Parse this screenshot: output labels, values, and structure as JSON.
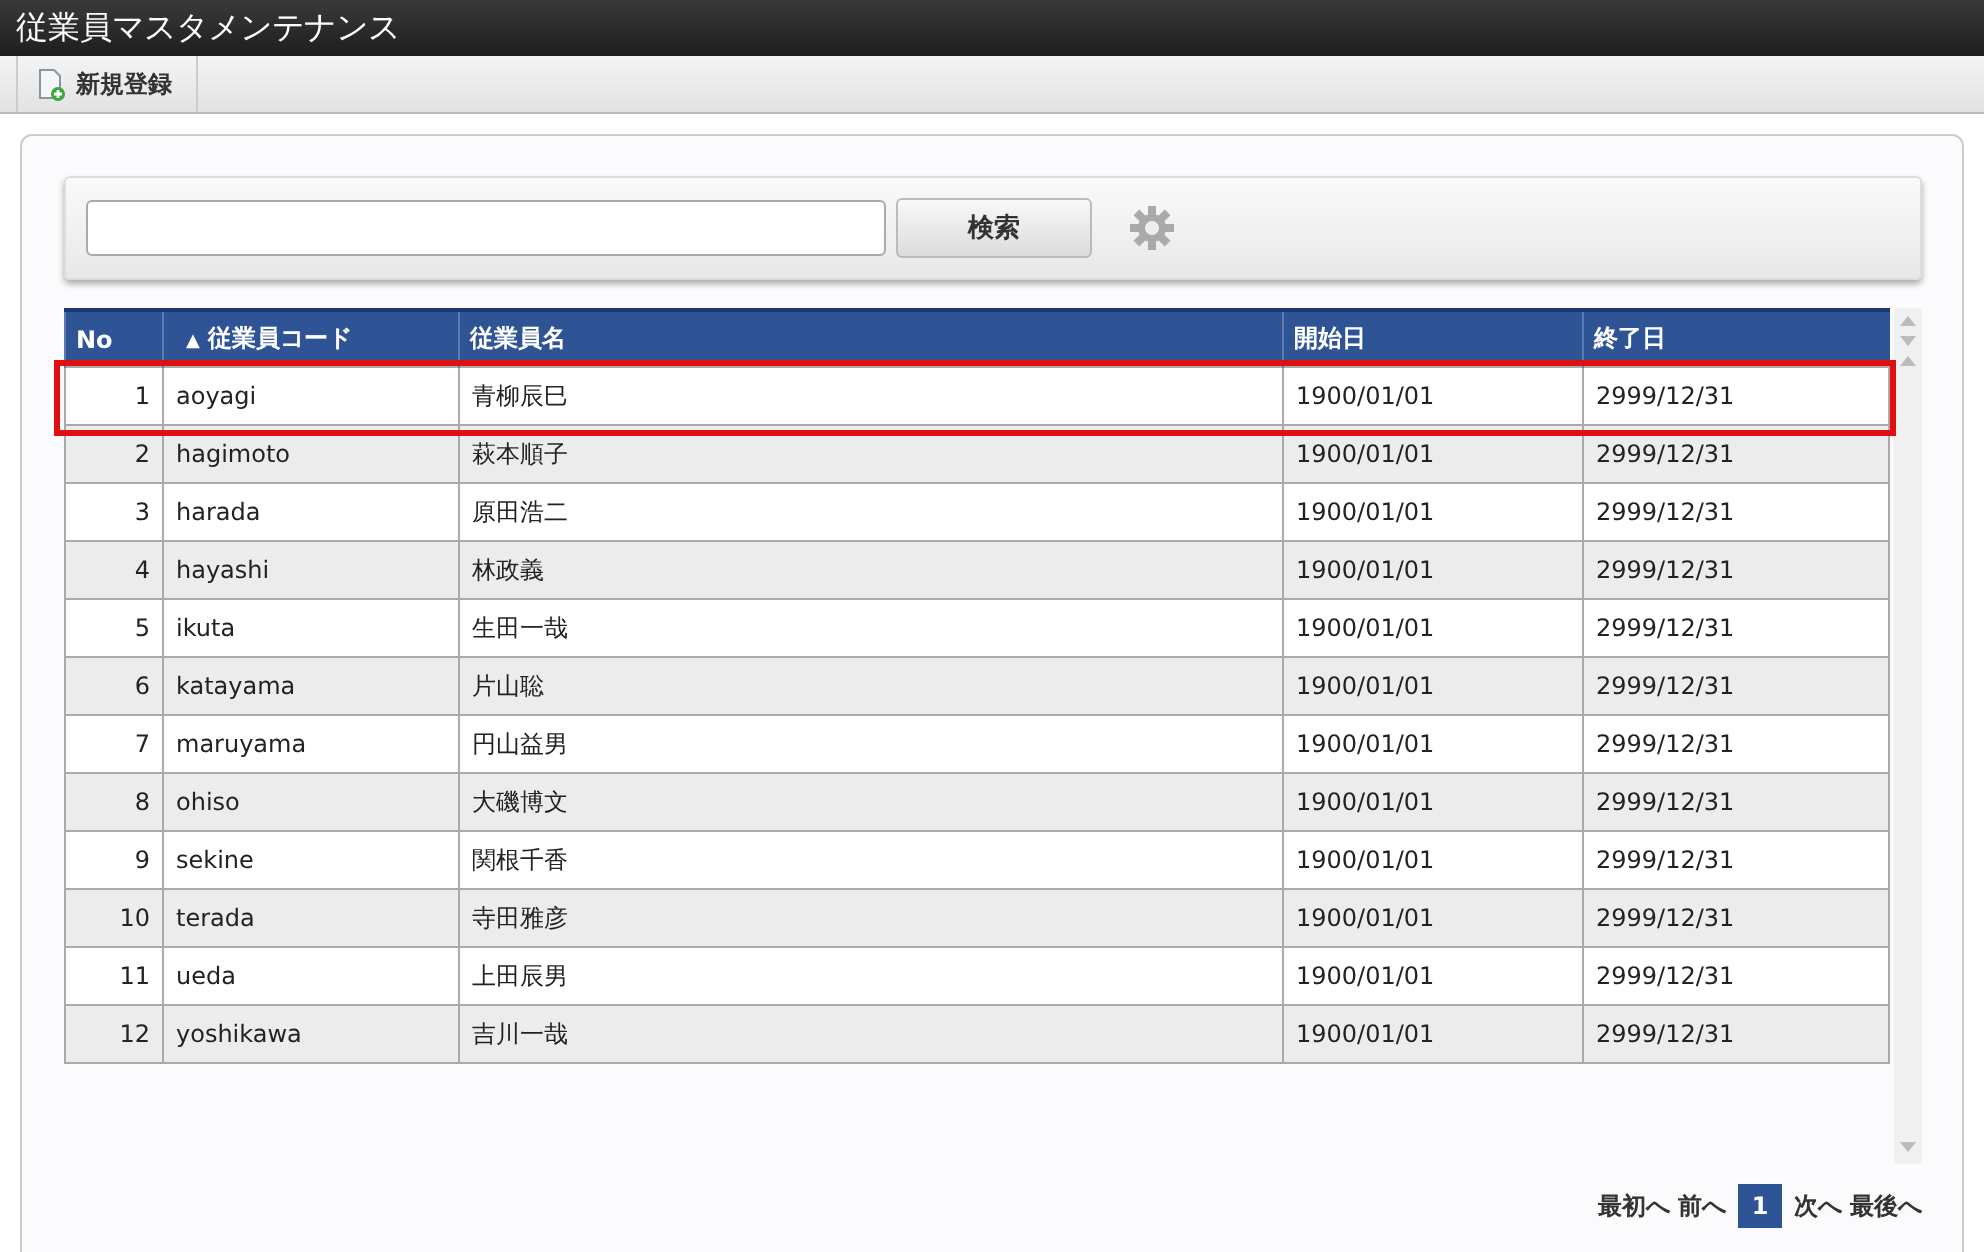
{
  "window": {
    "title": "従業員マスタメンテナンス"
  },
  "toolbar": {
    "buttons": [
      {
        "label": "新規登録"
      }
    ]
  },
  "search": {
    "button": "検索"
  },
  "table": {
    "columns": [
      {
        "label": "No"
      },
      {
        "label": "従業員コード",
        "sort_mark": "▲"
      },
      {
        "label": "従業員名"
      },
      {
        "label": "開始日"
      },
      {
        "label": "終了日"
      }
    ],
    "rows": [
      {
        "cells": [
          "1",
          "aoyagi",
          "青柳辰巳",
          "1900/01/01",
          "2999/12/31"
        ],
        "highlighted": true
      },
      {
        "cells": [
          "2",
          "hagimoto",
          "萩本順子",
          "1900/01/01",
          "2999/12/31"
        ],
        "highlighted": false
      },
      {
        "cells": [
          "3",
          "harada",
          "原田浩二",
          "1900/01/01",
          "2999/12/31"
        ],
        "highlighted": false
      },
      {
        "cells": [
          "4",
          "hayashi",
          "林政義",
          "1900/01/01",
          "2999/12/31"
        ],
        "highlighted": false
      },
      {
        "cells": [
          "5",
          "ikuta",
          "生田一哉",
          "1900/01/01",
          "2999/12/31"
        ],
        "highlighted": false
      },
      {
        "cells": [
          "6",
          "katayama",
          "片山聡",
          "1900/01/01",
          "2999/12/31"
        ],
        "highlighted": false
      },
      {
        "cells": [
          "7",
          "maruyama",
          "円山益男",
          "1900/01/01",
          "2999/12/31"
        ],
        "highlighted": false
      },
      {
        "cells": [
          "8",
          "ohiso",
          "大磯博文",
          "1900/01/01",
          "2999/12/31"
        ],
        "highlighted": false
      },
      {
        "cells": [
          "9",
          "sekine",
          "関根千香",
          "1900/01/01",
          "2999/12/31"
        ],
        "highlighted": false
      },
      {
        "cells": [
          "10",
          "terada",
          "寺田雅彦",
          "1900/01/01",
          "2999/12/31"
        ],
        "highlighted": false
      },
      {
        "cells": [
          "11",
          "ueda",
          "上田辰男",
          "1900/01/01",
          "2999/12/31"
        ],
        "highlighted": false
      },
      {
        "cells": [
          "12",
          "yoshikawa",
          "吉川一哉",
          "1900/01/01",
          "2999/12/31"
        ],
        "highlighted": false
      }
    ]
  },
  "pagination": {
    "first": "最初へ",
    "prev": "前へ",
    "pages": [
      {
        "label": "1",
        "selected": true
      }
    ],
    "next": "次へ",
    "last": "最後へ"
  }
}
